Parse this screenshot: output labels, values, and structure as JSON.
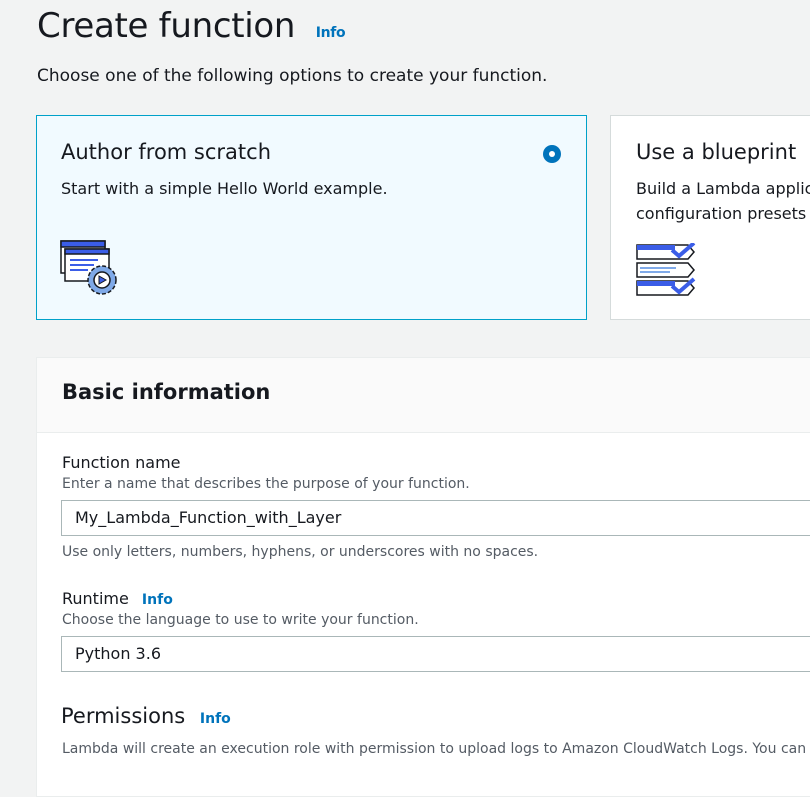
{
  "page": {
    "title": "Create function",
    "title_info": "Info",
    "subtitle": "Choose one of the following options to create your function."
  },
  "options": [
    {
      "title": "Author from scratch",
      "description": "Start with a simple Hello World example.",
      "selected": true
    },
    {
      "title": "Use a blueprint",
      "description_lines": [
        "Build a Lambda applic",
        "configuration presets f"
      ],
      "selected": false
    }
  ],
  "basic_info": {
    "title": "Basic information",
    "function_name": {
      "label": "Function name",
      "description": "Enter a name that describes the purpose of your function.",
      "value": "My_Lambda_Function_with_Layer",
      "constraint": "Use only letters, numbers, hyphens, or underscores with no spaces."
    },
    "runtime": {
      "label": "Runtime",
      "info": "Info",
      "description": "Choose the language to use to write your function.",
      "value": "Python 3.6"
    },
    "permissions": {
      "label": "Permissions",
      "info": "Info",
      "description": "Lambda will create an execution role with permission to upload logs to Amazon CloudWatch Logs. You can con"
    }
  },
  "colors": {
    "accent": "#0073bb",
    "selected_card_bg": "#f1faff",
    "selected_card_border": "#00a1c9",
    "icon_blue": "#3b5de7"
  }
}
